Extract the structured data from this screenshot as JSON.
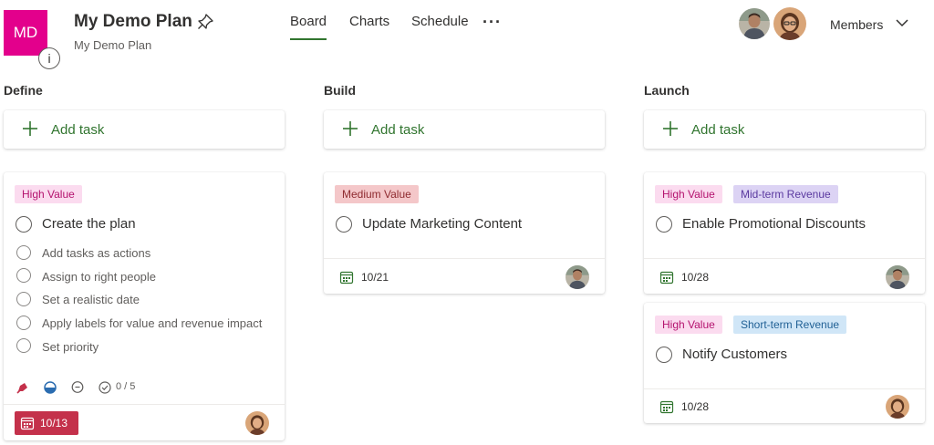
{
  "header": {
    "badge_initials": "MD",
    "info_label": "i",
    "plan_title": "My Demo Plan",
    "plan_subtitle": "My Demo Plan",
    "tabs": [
      "Board",
      "Charts",
      "Schedule"
    ],
    "more_label": "···",
    "members_label": "Members"
  },
  "colors": {
    "brand": "#e3008c",
    "accent": "#31752f",
    "overdue": "#c4314b"
  },
  "columns": [
    {
      "title": "Define",
      "add_label": "Add task",
      "cards": [
        {
          "tags": [
            "High Value"
          ],
          "title": "Create the plan",
          "checklist": [
            "Add tasks as actions",
            "Assign to right people",
            "Set a realistic date",
            "Apply labels for value and revenue impact",
            "Set priority"
          ],
          "checklist_progress": "0 / 5",
          "due": "10/13",
          "overdue": true
        }
      ]
    },
    {
      "title": "Build",
      "add_label": "Add task",
      "cards": [
        {
          "tags": [
            "Medium Value"
          ],
          "title": "Update Marketing Content",
          "due": "10/21"
        }
      ]
    },
    {
      "title": "Launch",
      "add_label": "Add task",
      "cards": [
        {
          "tags": [
            "High Value",
            "Mid-term Revenue"
          ],
          "title": "Enable Promotional Discounts",
          "due": "10/28"
        },
        {
          "tags": [
            "High Value",
            "Short-term Revenue"
          ],
          "title": "Notify Customers",
          "due": "10/28"
        }
      ]
    }
  ]
}
